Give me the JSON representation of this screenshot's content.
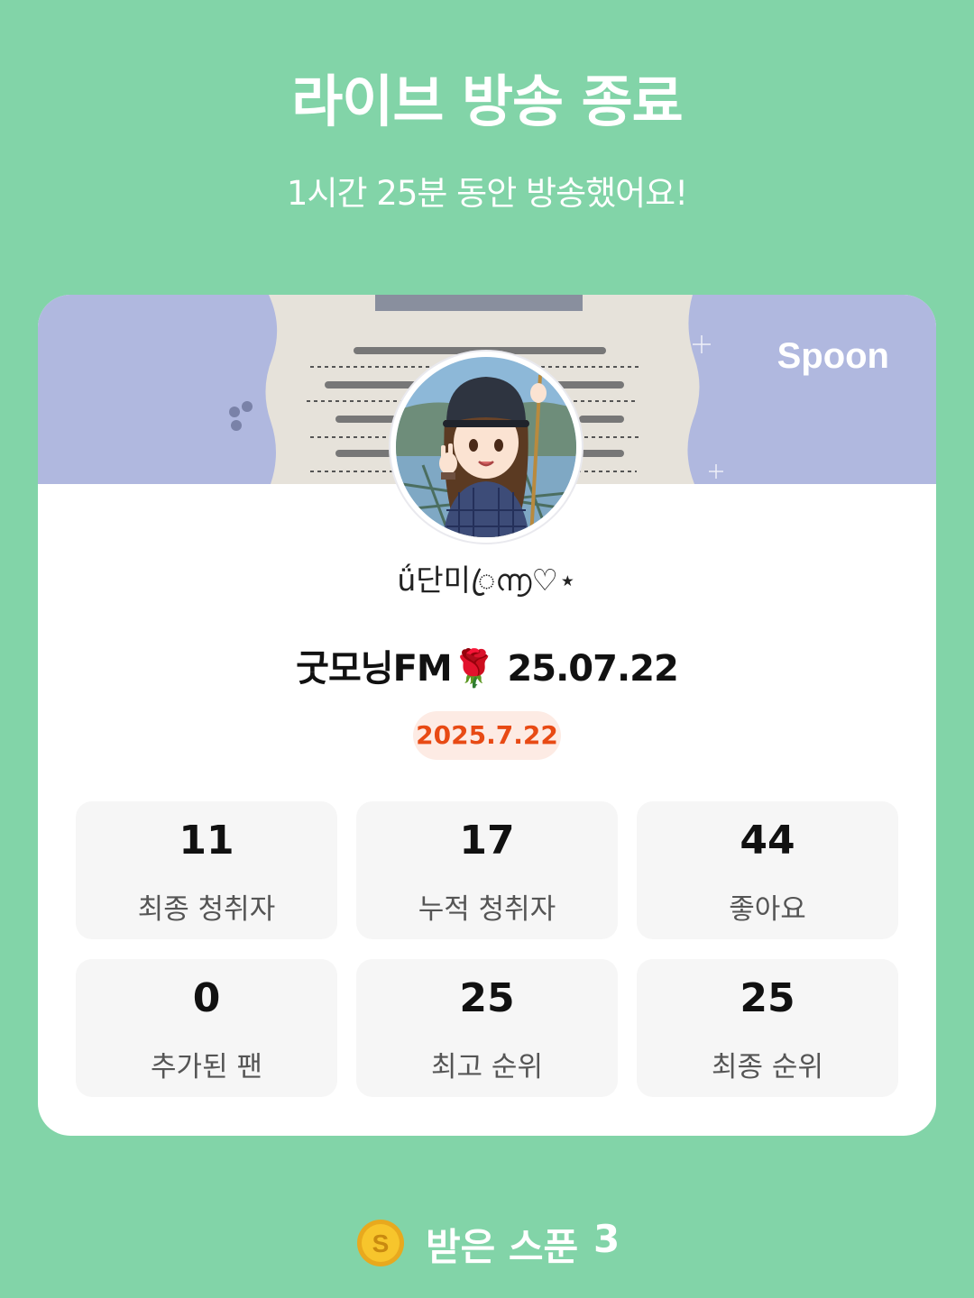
{
  "header": {
    "title": "라이브 방송 종료",
    "subtitle": "1시간 25분 동안 방송했어요!"
  },
  "card": {
    "brand": "Spoon",
    "nickname": "ǘ단미ꦿ൬♡⋆",
    "broadcast_title": "굿모닝FM🌹 25.07.22",
    "date": "2025.7.22",
    "stats": [
      {
        "value": "11",
        "label": "최종 청취자"
      },
      {
        "value": "17",
        "label": "누적 청취자"
      },
      {
        "value": "44",
        "label": "좋아요"
      },
      {
        "value": "0",
        "label": "추가된 팬"
      },
      {
        "value": "25",
        "label": "최고 순위"
      },
      {
        "value": "25",
        "label": "최종 순위"
      }
    ]
  },
  "footer": {
    "spoon_label": "받은 스푼",
    "spoon_count": "3",
    "coin_icon": "spoon-coin-icon"
  },
  "colors": {
    "background": "#82D4A8",
    "banner": "#B0B8DF",
    "date_badge_text": "#E84A14",
    "date_badge_bg": "#FDEBE4"
  }
}
